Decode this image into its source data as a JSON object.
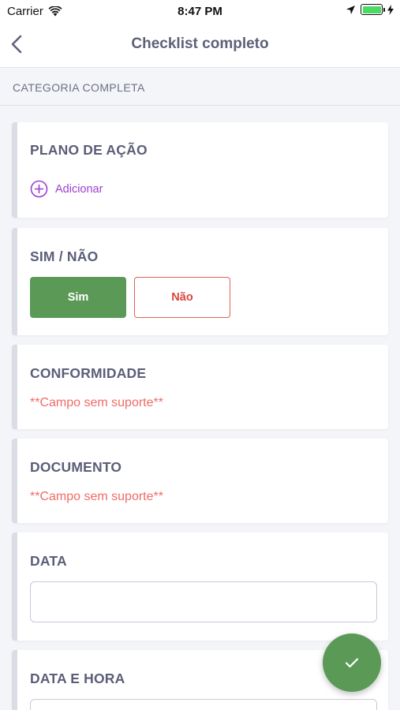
{
  "status_bar": {
    "carrier": "Carrier",
    "time": "8:47 PM"
  },
  "nav": {
    "title": "Checklist completo"
  },
  "section": {
    "header": "CATEGORIA COMPLETA"
  },
  "cards": {
    "plano": {
      "title": "PLANO DE AÇÃO",
      "add_label": "Adicionar"
    },
    "simnao": {
      "title": "SIM / NÃO",
      "yes_label": "Sim",
      "no_label": "Não",
      "selected": "Sim"
    },
    "conformidade": {
      "title": "CONFORMIDADE",
      "message": "**Campo sem suporte**"
    },
    "documento": {
      "title": "DOCUMENTO",
      "message": "**Campo sem suporte**"
    },
    "data": {
      "title": "DATA",
      "value": ""
    },
    "datahora": {
      "title": "DATA E HORA",
      "value": ""
    }
  },
  "colors": {
    "accent_green": "#5b9a56",
    "danger_red": "#e0605a",
    "purple": "#9b3fd0",
    "title_gray": "#5e6079"
  }
}
